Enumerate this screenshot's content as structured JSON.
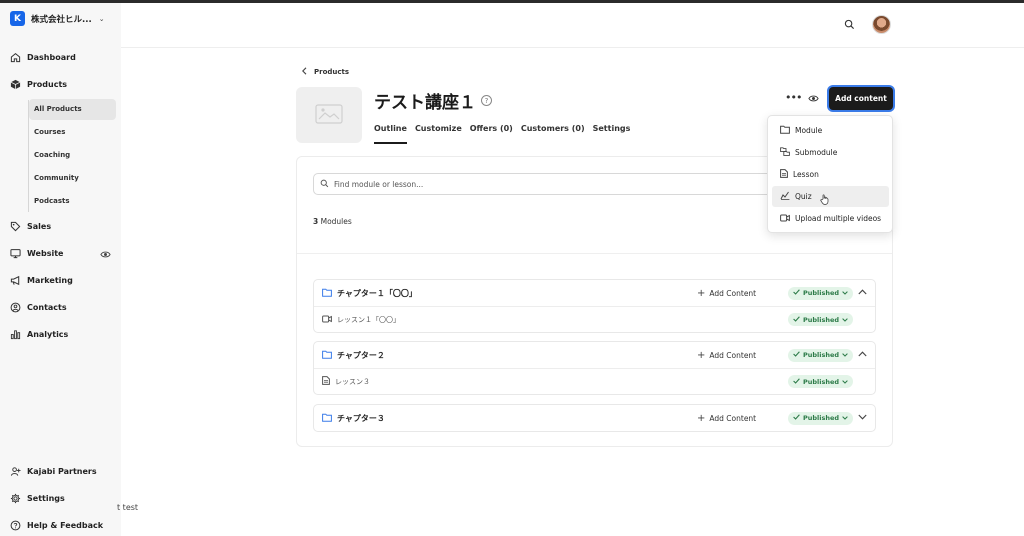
{
  "brand": {
    "logo_letter": "K",
    "name": "株式会社ヒル...",
    "chevron": "⌄"
  },
  "sidebar": {
    "items": [
      {
        "label": "Dashboard",
        "icon": "home-icon"
      },
      {
        "label": "Products",
        "icon": "box-icon"
      },
      {
        "label": "Sales",
        "icon": "tag-icon"
      },
      {
        "label": "Website",
        "icon": "monitor-icon"
      },
      {
        "label": "Marketing",
        "icon": "megaphone-icon"
      },
      {
        "label": "Contacts",
        "icon": "person-circle-icon"
      },
      {
        "label": "Analytics",
        "icon": "bar-chart-icon"
      }
    ],
    "product_subitems": [
      "All Products",
      "Courses",
      "Coaching",
      "Community",
      "Podcasts"
    ],
    "bottom_items": [
      {
        "label": "Kajabi Partners",
        "icon": "partners-icon"
      },
      {
        "label": "Settings",
        "icon": "gear-icon"
      },
      {
        "label": "Help & Feedback",
        "icon": "help-icon"
      }
    ],
    "stray_text": "t test"
  },
  "product": {
    "breadcrumb": "Products",
    "title": "テスト講座１",
    "tabs": [
      "Outline",
      "Customize",
      "Offers (0)",
      "Customers (0)",
      "Settings"
    ],
    "add_content_label": "Add content"
  },
  "outline": {
    "search_placeholder": "Find module or lesson...",
    "modules_count": "3",
    "modules_label": " Modules",
    "add_content_label": "Add Content",
    "published_label": "Published",
    "modules": [
      {
        "title": "チャプター１「〇〇」",
        "lesson": "レッスン１「〇〇」",
        "lesson_icon": "video-icon"
      },
      {
        "title": "チャプター２",
        "lesson": "レッスン３",
        "lesson_icon": "document-icon"
      },
      {
        "title": "チャプター３"
      }
    ]
  },
  "menu": {
    "items": [
      "Module",
      "Submodule",
      "Lesson",
      "Quiz",
      "Upload multiple videos"
    ]
  },
  "colors": {
    "accent": "#1766e8",
    "published_bg": "#e3f4e8",
    "published_text": "#2b7a47",
    "button_dark": "#1b1b1b"
  }
}
